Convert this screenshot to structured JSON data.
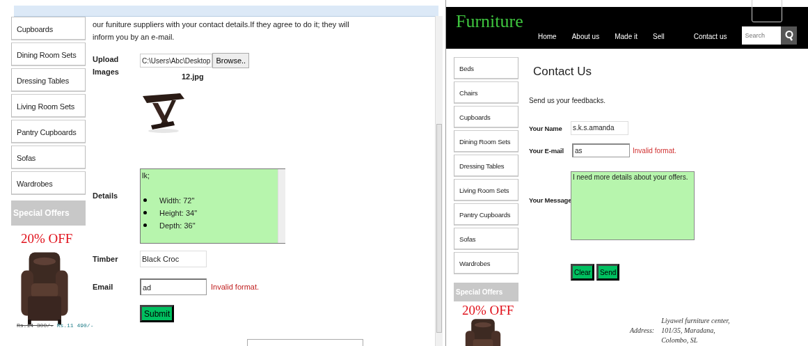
{
  "left_page": {
    "intro_text": "our funiture suppliers with your contact details.If they agree to do it; they will inform you by an e-mail.",
    "sidebar": {
      "items": [
        {
          "label": "Cupboards"
        },
        {
          "label": "Dining Room Sets"
        },
        {
          "label": "Dressing Tables"
        },
        {
          "label": "Living Room Sets"
        },
        {
          "label": "Pantry Cupboards"
        },
        {
          "label": "Sofas"
        },
        {
          "label": "Wardrobes"
        }
      ]
    },
    "special_offers": {
      "title": "Special Offers",
      "badge": "20% OFF",
      "old_price": "Rs.14 300/-",
      "new_price": "Rs.11 490/-"
    },
    "form": {
      "upload_label": "Upload Images",
      "file_path": "C:\\Users\\Abc\\Desktop",
      "browse_button": "Browse..",
      "file_name": "12.jpg",
      "details_label": "Details",
      "details_first_line": "lk;",
      "details_items": [
        "Width: 72\"",
        "Height: 34\"",
        "Depth: 36\""
      ],
      "timber_label": "Timber",
      "timber_value": "Black Croc",
      "email_label": "Email",
      "email_value": "ad",
      "email_error": "Invalid format.",
      "submit_button": "Submit"
    }
  },
  "right_page": {
    "logo": "Furniture",
    "nav": [
      {
        "label": "Home"
      },
      {
        "label": "About us"
      },
      {
        "label": "Made it"
      },
      {
        "label": "Sell"
      },
      {
        "label": "Contact us"
      }
    ],
    "search": {
      "placeholder": "Search"
    },
    "sidebar": {
      "items": [
        {
          "label": "Beds"
        },
        {
          "label": "Chairs"
        },
        {
          "label": "Cupboards"
        },
        {
          "label": "Dining Room Sets"
        },
        {
          "label": "Dressing Tables"
        },
        {
          "label": "Living Room Sets"
        },
        {
          "label": "Pantry Cupboards"
        },
        {
          "label": "Sofas"
        },
        {
          "label": "Wardrobes"
        }
      ]
    },
    "special_offers": {
      "title": "Special Offers",
      "badge": "20% OFF"
    },
    "heading": "Contact Us",
    "intro_text": "Send us your feedbacks.",
    "form": {
      "name_label": "Your Name",
      "name_value": "s.k.s.amanda",
      "email_label": "Your E-mail",
      "email_value": "as",
      "email_error": "Invalid format.",
      "message_label": "Your Message",
      "message_value": "I need more details about your offers.",
      "buttons": [
        "Clear",
        "Send"
      ]
    },
    "address": {
      "label": "Address:",
      "lines": [
        "Liyawel furniture center,",
        "101/35, Maradana,",
        "Colombo, SL"
      ]
    }
  }
}
